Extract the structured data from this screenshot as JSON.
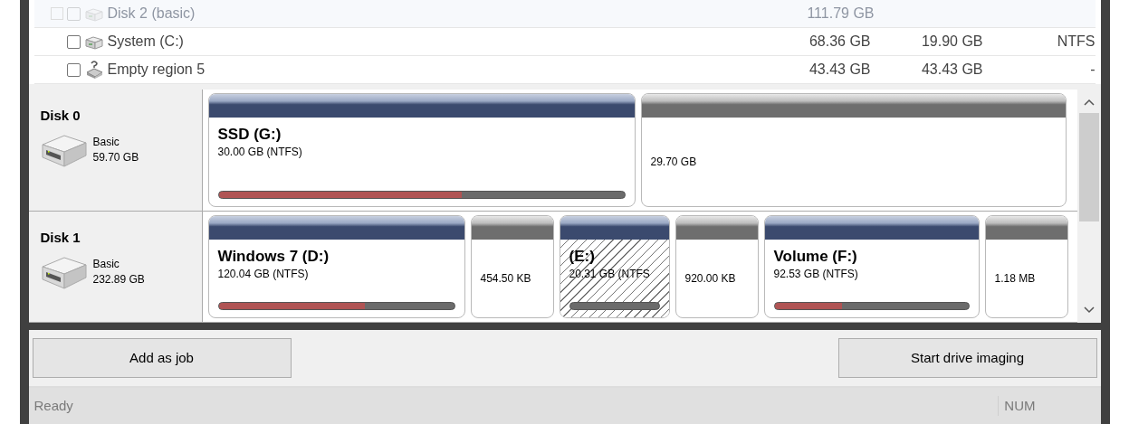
{
  "volume_list": {
    "rows": [
      {
        "kind": "disk",
        "name": "Disk 2 (basic)",
        "checked": false,
        "faded": true,
        "size": "111.79 GB",
        "free": "",
        "filesystem": ""
      },
      {
        "kind": "volume",
        "name": "System (C:)",
        "checked": false,
        "faded": false,
        "size": "68.36 GB",
        "free": "19.90 GB",
        "filesystem": "NTFS"
      },
      {
        "kind": "empty",
        "name": "Empty region 5",
        "checked": false,
        "faded": false,
        "size": "43.43 GB",
        "free": "43.43 GB",
        "filesystem": "-"
      }
    ]
  },
  "disk_map": {
    "disks": [
      {
        "name": "Disk 0",
        "type": "Basic",
        "size": "59.70 GB",
        "partitions": [
          {
            "kind": "volume",
            "name": "SSD (G:)",
            "detail": "30.00 GB (NTFS)",
            "level": 0.6,
            "hatched": false
          },
          {
            "kind": "unallocated",
            "detail": "29.70 GB"
          }
        ]
      },
      {
        "name": "Disk 1",
        "type": "Basic",
        "size": "232.89 GB",
        "partitions": [
          {
            "kind": "volume",
            "name": "Windows 7 (D:)",
            "detail": "120.04 GB (NTFS)",
            "level": 0.62,
            "hatched": false
          },
          {
            "kind": "unallocated",
            "detail": "454.50 KB"
          },
          {
            "kind": "volume",
            "name": "(E:)",
            "detail": "20.31 GB (NTFS",
            "level": 0,
            "hatched": true
          },
          {
            "kind": "unallocated",
            "detail": "920.00 KB"
          },
          {
            "kind": "volume",
            "name": "Volume (F:)",
            "detail": "92.53 GB (NTFS)",
            "level": 0.35,
            "hatched": false
          },
          {
            "kind": "unallocated",
            "detail": "1.18 MB"
          }
        ]
      }
    ]
  },
  "buttons": [
    "Add as job",
    "Start drive imaging"
  ],
  "status_bar": {
    "text": "Ready",
    "indicator": "NUM"
  }
}
